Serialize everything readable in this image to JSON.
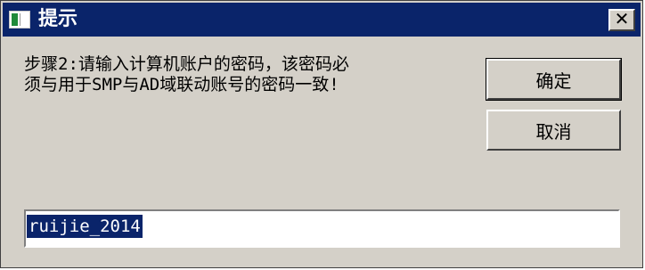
{
  "window": {
    "title": "提示",
    "close_glyph": "✕",
    "colors": {
      "titlebar": "#0a246a",
      "face": "#d4d0c8",
      "selection": "#0a246a"
    }
  },
  "dialog": {
    "message": "步骤2:请输入计算机账户的密码，该密码必\n须与用于SMP与AD域联动账号的密码一致!",
    "ok_label": "确定",
    "cancel_label": "取消",
    "input": {
      "value": "ruijie_2014",
      "selected": true
    }
  },
  "icons": {
    "app": "window-app-icon",
    "close": "close-icon"
  }
}
